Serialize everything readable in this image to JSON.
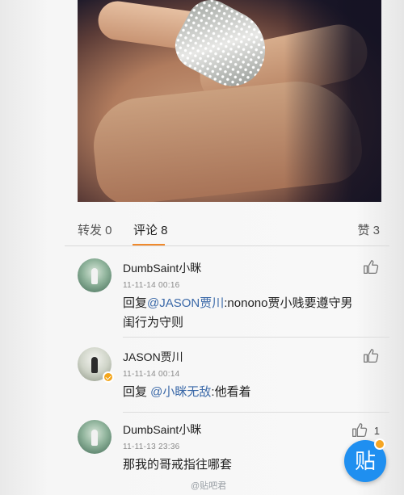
{
  "tabs": {
    "repost": "转发 0",
    "comment": "评论 8",
    "like": "赞 3"
  },
  "comments": [
    {
      "username": "DumbSaint小眯",
      "time": "11-11-14 00:16",
      "reply_prefix": "回复",
      "mention": "@JASON贾川",
      "text_line1": ":nonono贾小贱要遵守男",
      "text_line2": "闺行为守则",
      "likes": ""
    },
    {
      "username": "JASON贾川",
      "time": "11-11-14 00:14",
      "reply_prefix": "回复 ",
      "mention": "@小眯无敌",
      "text_line1": ":他看着",
      "verified": true,
      "likes": ""
    },
    {
      "username": "DumbSaint小眯",
      "time": "11-11-13 23:36",
      "text_line1": "那我的哥戒指往哪套",
      "likes": "1"
    }
  ],
  "fab": {
    "label": "贴"
  },
  "watermark": "@贴吧君",
  "colors": {
    "accent": "#f08a2c",
    "mention": "#3b69a8",
    "fab": "#1f8ff0"
  }
}
